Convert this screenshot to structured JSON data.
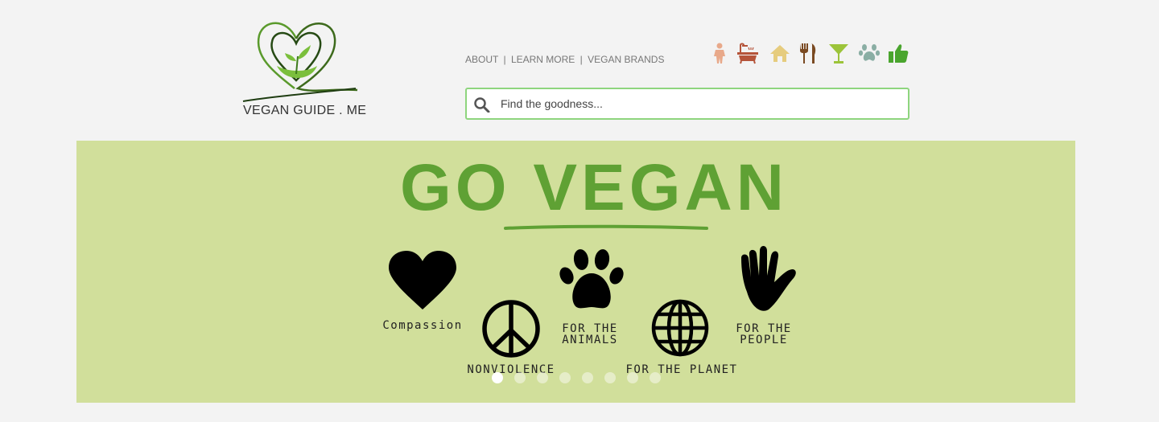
{
  "logo": {
    "text": "VEGAN GUIDE . ME"
  },
  "nav": {
    "about": "ABOUT",
    "learn_more": "LEARN MORE",
    "vegan_brands": "VEGAN BRANDS",
    "separator": "|"
  },
  "categories": [
    {
      "icon": "person-icon",
      "color": "#e8a98a"
    },
    {
      "icon": "bathtub-icon",
      "color": "#b5543a"
    },
    {
      "icon": "home-icon",
      "color": "#e6cc7e"
    },
    {
      "icon": "utensils-icon",
      "color": "#7a4a22"
    },
    {
      "icon": "cocktail-icon",
      "color": "#9cc43a"
    },
    {
      "icon": "paw-icon",
      "color": "#8aaea4"
    },
    {
      "icon": "thumbs-up-icon",
      "color": "#4aa52e"
    }
  ],
  "search": {
    "placeholder": "Find the goodness..."
  },
  "banner": {
    "title": "GO VEGAN",
    "items": {
      "compassion": "Compassion",
      "nonviolence": "NONVIOLENCE",
      "animals_line1": "FOR THE",
      "animals_line2": "ANIMALS",
      "planet": "FOR THE PLANET",
      "people_line1": "FOR THE",
      "people_line2": "PEOPLE"
    },
    "background": "#d1df9b",
    "title_color": "#5fa134"
  },
  "carousel": {
    "slide_count": 8,
    "active_index": 0
  }
}
